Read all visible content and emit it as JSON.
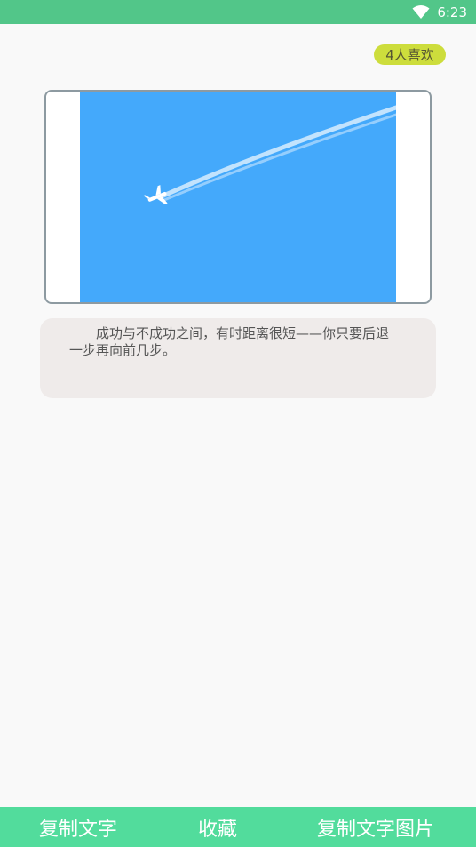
{
  "status_bar": {
    "time": "6:23",
    "icon": "wifi-icon"
  },
  "likes": {
    "label": "4人喜欢"
  },
  "image": {
    "icon": "airplane-sky-image",
    "sky_color": "#44a9fb"
  },
  "quote": {
    "text": "成功与不成功之间，有时距离很短——你只要后退一步再向前几步。"
  },
  "bottom_bar": {
    "copy_text": "复制文字",
    "favorite": "收藏",
    "copy_text_image": "复制文字图片"
  },
  "colors": {
    "accent": "#52c689",
    "bottom_bar": "#52dc9c",
    "badge": "#cddd3c"
  }
}
